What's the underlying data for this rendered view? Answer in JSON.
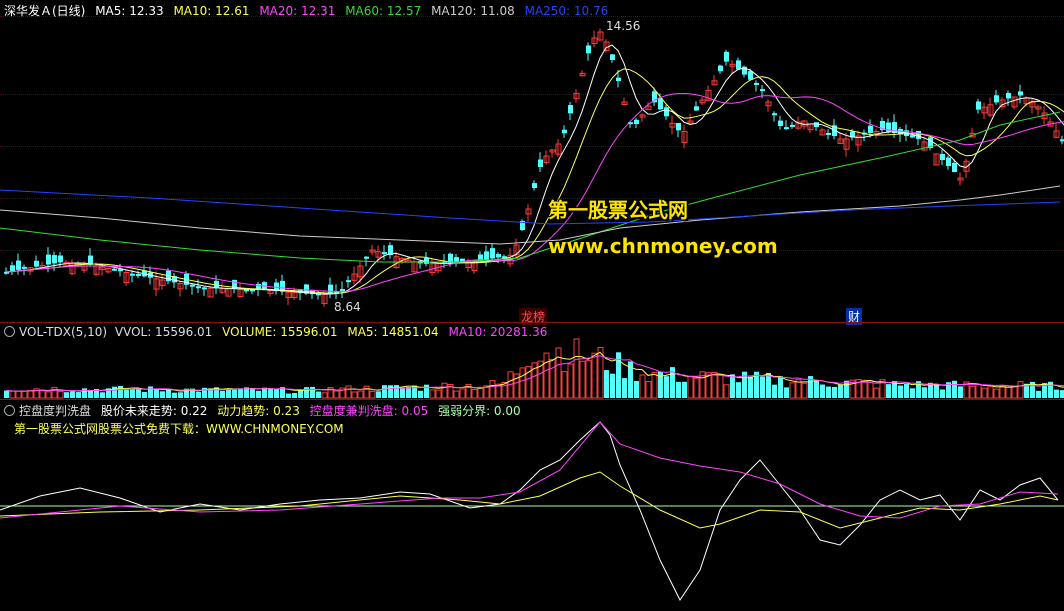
{
  "main": {
    "stock_title": "深华发Ａ(日线)",
    "ma": [
      {
        "label": "MA5: 12.33",
        "color": "#ffffff"
      },
      {
        "label": "MA10: 12.61",
        "color": "#ffff55"
      },
      {
        "label": "MA20: 12.31",
        "color": "#ff44ff"
      },
      {
        "label": "MA60: 12.57",
        "color": "#33dd33"
      },
      {
        "label": "MA120: 11.08",
        "color": "#cccccc"
      },
      {
        "label": "MA250: 10.76",
        "color": "#2244ff"
      }
    ],
    "high_label": "14.56",
    "low_label": "8.64",
    "marker_dragon": "龙榜",
    "marker_finance": "财",
    "watermark_1": "第一股票公式网",
    "watermark_2": "www.chnmoney.com"
  },
  "volume": {
    "name": "VOL-TDX(5,10)",
    "vvol": "VVOL: 15596.01",
    "volume": "VOLUME: 15596.01",
    "ma5": "MA5: 14851.04",
    "ma10": "MA10: 20281.36"
  },
  "indicator": {
    "name": "控盘度判洗盘",
    "trend": "股价未来走势: 0.22",
    "power": "动力趋势: 0.23",
    "control": "控盘度兼判洗盘: 0.05",
    "divide": "强弱分界: 0.00",
    "sub_line": "第一股票公式网股票公式免费下载：WWW.CHNMONEY.COM"
  },
  "colors": {
    "up": "#ff3c3c",
    "down": "#54ffff",
    "ma5": "#ffffff",
    "ma10": "#ffff55",
    "ma20": "#ff44ff",
    "ma60": "#33dd33",
    "ma120": "#cccccc",
    "ma250": "#2244ff",
    "grid": "#5a0a0a"
  }
}
